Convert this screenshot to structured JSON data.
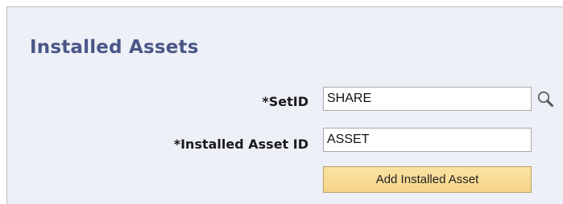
{
  "page": {
    "title": "Installed Assets"
  },
  "form": {
    "setid_label": "*SetID",
    "setid_value": "SHARE",
    "asset_id_label": "*Installed Asset ID",
    "asset_id_value": "ASSET",
    "add_button_label": "Add Installed Asset",
    "lookup_icon": "magnifying-glass"
  },
  "colors": {
    "title": "#4a5686",
    "panel_background": "#eef0f7",
    "button_background": "#f9dd97"
  }
}
